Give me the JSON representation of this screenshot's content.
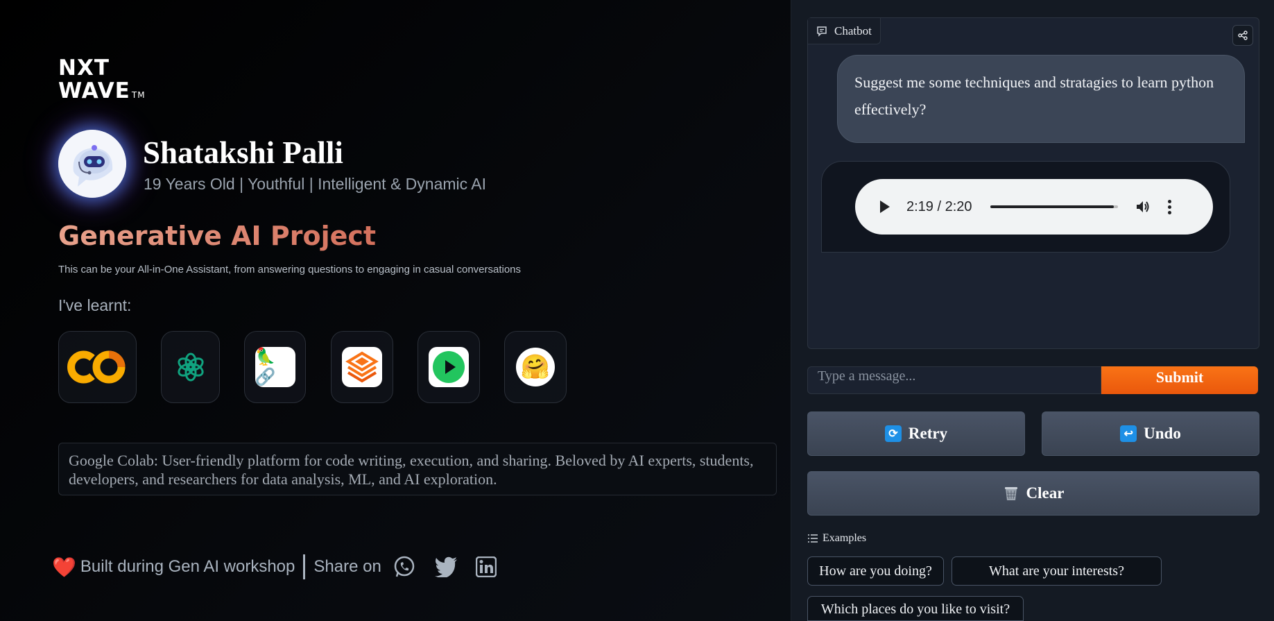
{
  "brand": {
    "logo_line1": "NXT",
    "logo_line2": "WAVE",
    "logo_tm": "TM"
  },
  "profile": {
    "name": "Shatakshi Palli",
    "tagline": "19 Years Old | Youthful | Intelligent & Dynamic AI"
  },
  "project": {
    "title": "Generative AI Project",
    "description": "This can be your All-in-One Assistant, from answering questions to engaging in casual conversations"
  },
  "learnt": {
    "label": "I've learnt:",
    "tools": [
      {
        "name": "google-colab-icon",
        "glyph": "CO"
      },
      {
        "name": "openai-icon"
      },
      {
        "name": "langchain-icon",
        "glyph": "🦜🔗"
      },
      {
        "name": "stack-layers-icon"
      },
      {
        "name": "play-icon"
      },
      {
        "name": "huggingface-icon",
        "glyph": "🤗"
      }
    ],
    "selected_description": "Google Colab: User-friendly platform for code writing, execution, and sharing. Beloved by AI experts, students, developers, and researchers for data analysis, ML, and AI exploration."
  },
  "footer": {
    "heart": "❤️",
    "built_text": "Built during Gen AI workshop",
    "share_label": "Share on"
  },
  "chatbot": {
    "label": "Chatbot",
    "user_message": "Suggest me some techniques and stratagies to learn python effectively?",
    "audio": {
      "time": "2:19 / 2:20",
      "progress": 0.97
    },
    "input_placeholder": "Type a message...",
    "input_value": "",
    "submit_label": "Submit",
    "retry_label": "Retry",
    "undo_label": "Undo",
    "clear_label": "Clear",
    "examples_label": "Examples",
    "examples": [
      "How are you doing?",
      "What are your interests?",
      "Which places do you like to visit?"
    ]
  },
  "colors": {
    "accent": "#f97316",
    "title_gradient": "#e0907a",
    "panel_bg": "#141a23",
    "button_icon": "#1e90e6"
  }
}
